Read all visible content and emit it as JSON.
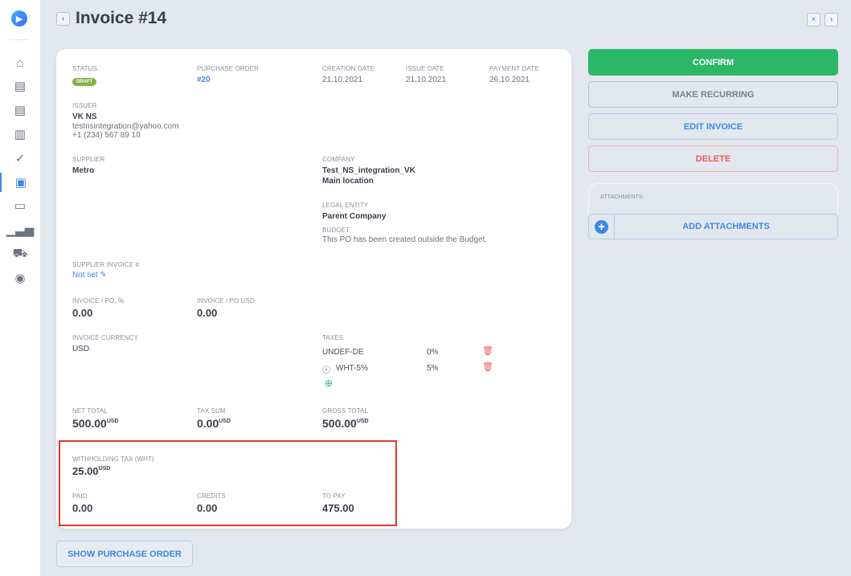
{
  "header": {
    "title": "Invoice #14",
    "back": "‹",
    "close": "×",
    "next": "›"
  },
  "sidebar": {
    "items": [
      "home-icon",
      "document-icon",
      "document-icon",
      "receipt-icon",
      "check-circle-icon",
      "wallet-icon",
      "card-icon",
      "chart-icon",
      "truck-icon",
      "toggle-icon"
    ],
    "active_index": 5
  },
  "invoice": {
    "status_label": "STATUS",
    "status": "DRAFT",
    "po_label": "PURCHASE ORDER",
    "po": "#20",
    "creation_label": "CREATION DATE",
    "creation": "21.10.2021",
    "issue_label": "ISSUE DATE",
    "issue": "21.10.2021",
    "payment_label": "PAYMENT DATE",
    "payment": "26.10.2021",
    "issuer_label": "ISSUER",
    "issuer_name": "VK NS",
    "issuer_email": "testnsintegration@yahoo.com",
    "issuer_phone": "+1 (234) 567 89 10",
    "supplier_label": "SUPPLIER",
    "supplier": "Metro",
    "company_label": "COMPANY",
    "company": "Test_NS_integration_VK",
    "location": "Main location",
    "legal_label": "LEGAL ENTITY",
    "legal": "Parent Company",
    "budget_label": "BUDGET",
    "budget": "This PO has been created outside the Budget.",
    "supinv_label": "SUPPLIER INVOICE #",
    "supinv": "Not set",
    "inv_po_pct_label": "INVOICE / PO, %",
    "inv_po_pct": "0.00",
    "inv_po_usd_label": "INVOICE / PO USD",
    "inv_po_usd": "0.00",
    "currency_label": "INVOICE CURRENCY",
    "currency": "USD",
    "taxes_label": "TAXES",
    "taxes": [
      {
        "name": "UNDEF-DE",
        "rate": "0%"
      },
      {
        "name": "WHT-5%",
        "rate": "5%"
      }
    ],
    "net_label": "NET TOTAL",
    "net": "500.00",
    "taxsum_label": "TAX SUM",
    "taxsum": "0.00",
    "gross_label": "GROSS TOTAL",
    "gross": "500.00",
    "unit": "USD",
    "wht_label": "WITHHOLDING TAX (WHT)",
    "wht": "25.00",
    "paid_label": "PAID",
    "paid": "0.00",
    "credits_label": "CREDITS",
    "credits": "0.00",
    "topay_label": "TO PAY",
    "topay": "475.00"
  },
  "actions": {
    "confirm": "CONFIRM",
    "recurring": "MAKE RECURRING",
    "edit": "EDIT INVOICE",
    "delete": "DELETE",
    "attachments_label": "ATTACHMENTS:",
    "add_attachments": "ADD ATTACHMENTS",
    "show_po": "SHOW PURCHASE ORDER"
  },
  "colors": {
    "confirm": "#2cb768",
    "accent": "#3d8ae5",
    "danger": "#f05a5a",
    "draft": "#86b04a"
  }
}
